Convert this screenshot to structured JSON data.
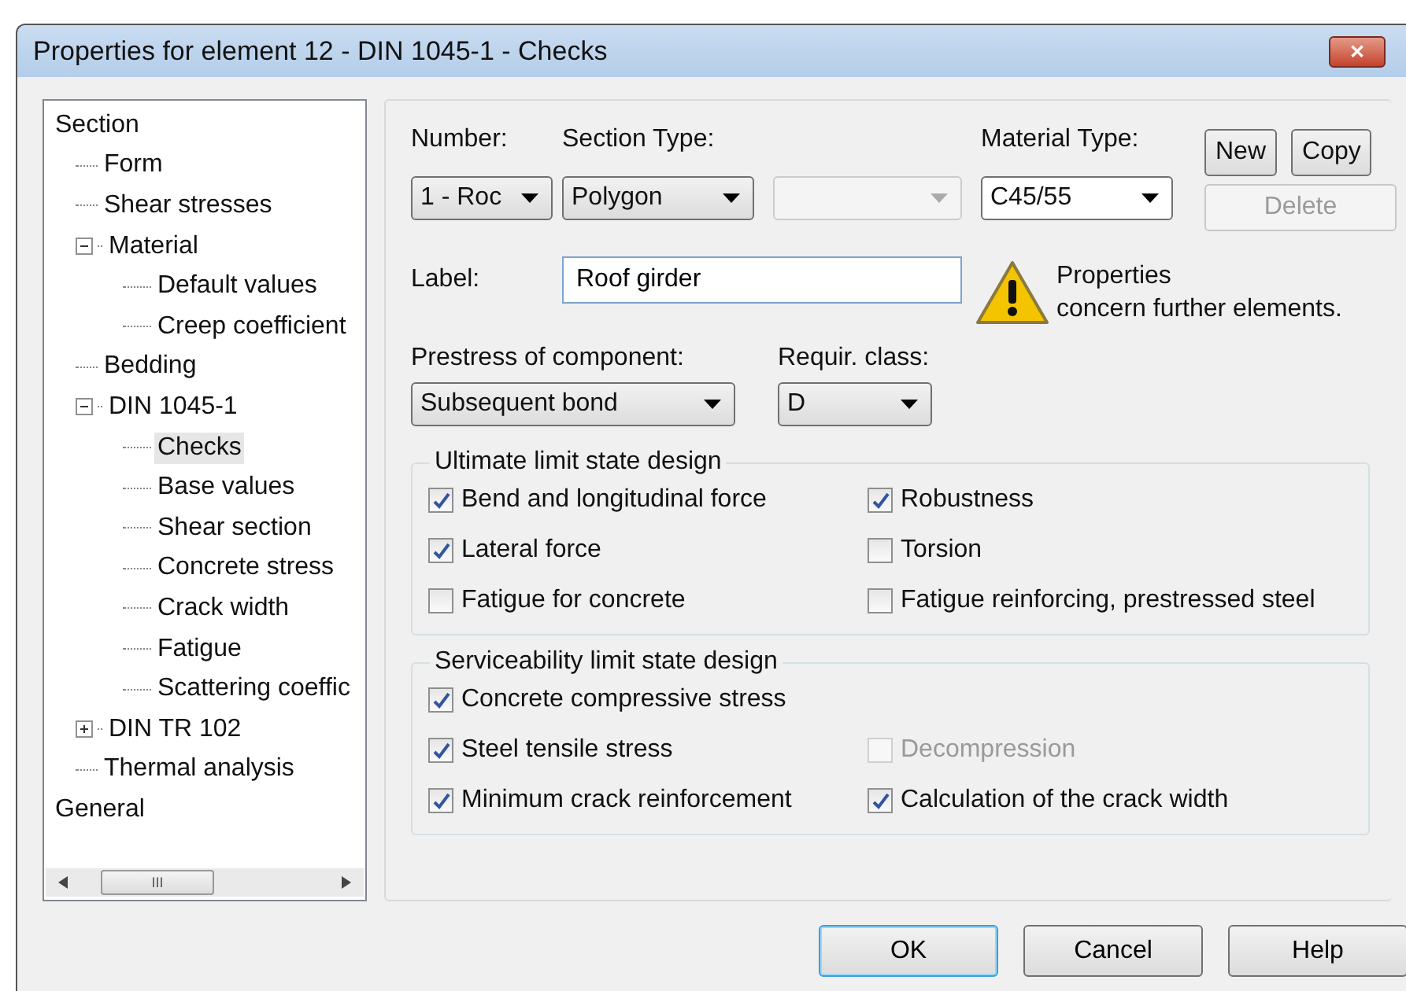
{
  "window": {
    "title": "Properties for element 12 - DIN 1045-1 - Checks",
    "close": "✕"
  },
  "tree": {
    "items": [
      {
        "label": "Section",
        "selected": false,
        "children": [
          {
            "label": "Form",
            "selected": false
          },
          {
            "label": "Shear stresses",
            "selected": false
          },
          {
            "label": "Material",
            "selected": false,
            "expanded": true,
            "children": [
              {
                "label": "Default values",
                "selected": false
              },
              {
                "label": "Creep coefficient",
                "selected": false
              }
            ]
          },
          {
            "label": "Bedding",
            "selected": false
          },
          {
            "label": "DIN 1045-1",
            "selected": false,
            "expanded": true,
            "children": [
              {
                "label": "Checks",
                "selected": true
              },
              {
                "label": "Base values",
                "selected": false
              },
              {
                "label": "Shear section",
                "selected": false
              },
              {
                "label": "Concrete stress",
                "selected": false
              },
              {
                "label": "Crack width",
                "selected": false
              },
              {
                "label": "Fatigue",
                "selected": false
              },
              {
                "label": "Scattering coeffic",
                "selected": false
              }
            ]
          },
          {
            "label": "DIN TR 102",
            "selected": false,
            "expanded": false
          },
          {
            "label": "Thermal analysis",
            "selected": false
          }
        ]
      },
      {
        "label": "General",
        "selected": false
      }
    ],
    "scrollbar": {
      "grip": "III"
    }
  },
  "number": {
    "label": "Number:",
    "value": "1 - Roc"
  },
  "section_type": {
    "label": "Section Type:",
    "value": "Polygon"
  },
  "section_extra": {
    "disabled": true
  },
  "material_type": {
    "label": "Material Type:",
    "value": "C45/55"
  },
  "buttons_side": [
    {
      "label": "New",
      "disabled": false
    },
    {
      "label": "Copy",
      "disabled": false
    },
    {
      "label": "Delete",
      "disabled": true
    }
  ],
  "label_field": {
    "label": "Label:",
    "value": "Roof girder"
  },
  "warning": {
    "lines": [
      "Properties",
      "concern further elements."
    ]
  },
  "prestress": {
    "label": "Prestress of component:",
    "value": "Subsequent bond"
  },
  "requir_class": {
    "label": "Requir. class:",
    "value": "D"
  },
  "groups": [
    {
      "title": "Ultimate limit state design",
      "rows": [
        [
          {
            "label": "Bend and longitudinal force",
            "checked": true,
            "disabled": false
          },
          {
            "label": "Robustness",
            "checked": true,
            "disabled": false
          }
        ],
        [
          {
            "label": "Lateral force",
            "checked": true,
            "disabled": false
          },
          {
            "label": "Torsion",
            "checked": false,
            "disabled": false
          }
        ],
        [
          {
            "label": "Fatigue for concrete",
            "checked": false,
            "disabled": false
          },
          {
            "label": "Fatigue reinforcing, prestressed steel",
            "checked": false,
            "disabled": false
          }
        ]
      ]
    },
    {
      "title": "Serviceability limit state design",
      "rows": [
        [
          {
            "label": "Concrete compressive stress",
            "checked": true,
            "disabled": false
          }
        ],
        [
          {
            "label": "Steel tensile stress",
            "checked": true,
            "disabled": false
          },
          {
            "label": "Decompression",
            "checked": false,
            "disabled": true
          }
        ],
        [
          {
            "label": "Minimum crack reinforcement",
            "checked": true,
            "disabled": false
          },
          {
            "label": "Calculation of the crack width",
            "checked": true,
            "disabled": false
          }
        ]
      ]
    }
  ],
  "footer_buttons": [
    {
      "label": "OK",
      "default": true
    },
    {
      "label": "Cancel",
      "default": false
    },
    {
      "label": "Help",
      "default": false
    }
  ]
}
